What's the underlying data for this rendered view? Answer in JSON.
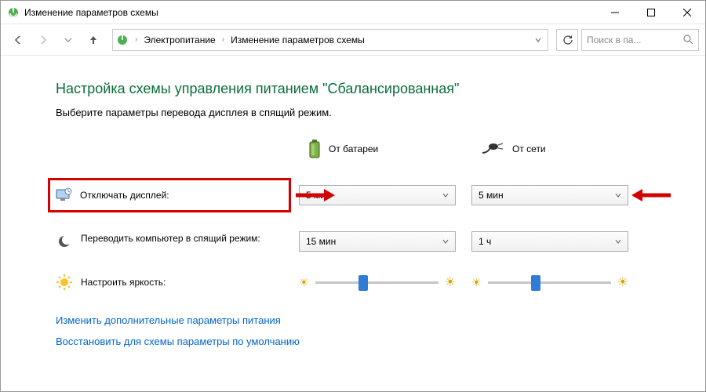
{
  "window": {
    "title": "Изменение параметров схемы"
  },
  "breadcrumb": {
    "item1": "Электропитание",
    "item2": "Изменение параметров схемы"
  },
  "search": {
    "placeholder": "Поиск в па..."
  },
  "page": {
    "heading": "Настройка схемы управления питанием \"Сбалансированная\"",
    "subtitle": "Выберите параметры перевода дисплея в спящий режим."
  },
  "columns": {
    "battery": "От батареи",
    "plugged": "От сети"
  },
  "rows": {
    "display_off": {
      "label": "Отключать дисплей:",
      "battery_value": "5 мин",
      "plugged_value": "5 мин"
    },
    "sleep": {
      "label": "Переводить компьютер в спящий режим:",
      "battery_value": "15 мин",
      "plugged_value": "1 ч"
    },
    "brightness": {
      "label": "Настроить яркость:"
    }
  },
  "links": {
    "advanced": "Изменить дополнительные параметры питания",
    "restore": "Восстановить для схемы параметры по умолчанию"
  }
}
